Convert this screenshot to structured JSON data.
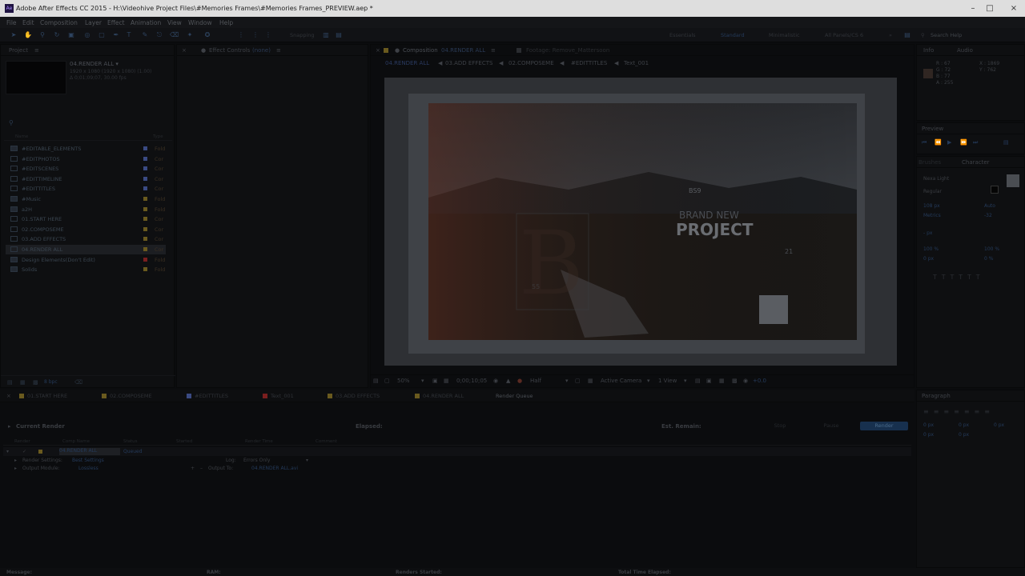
{
  "window": {
    "title": "Adobe After Effects CC 2015 - H:\\Videohive Project Files\\#Memories Frames\\#Memories Frames_PREVIEW.aep *",
    "logo_text": "Ae"
  },
  "menu": [
    "File",
    "Edit",
    "Composition",
    "Layer",
    "Effect",
    "Animation",
    "View",
    "Window",
    "Help"
  ],
  "toolbar": {
    "snapping_label": "Snapping",
    "workspaces": [
      "Essentials",
      "Standard",
      "Minimalistic",
      "All Panels/CS 6"
    ],
    "search_placeholder": "Search Help"
  },
  "project_panel": {
    "tab": "Project",
    "selected_name": "04.RENDER ALL ▾",
    "selected_info_1": "1920 x 1080  (1920 x 1080) (1.00)",
    "selected_info_2": "Δ 0;01;09;07, 30.00 fps",
    "col_name": "Name",
    "col_type": "Type",
    "items": [
      {
        "name": "#EDITABLE_ELEMENTS",
        "type": "Fold",
        "color": "#3a4a82"
      },
      {
        "name": "#EDITPHOTOS",
        "type": "Cor",
        "color": "#3a4a82"
      },
      {
        "name": "#EDITSCENES",
        "type": "Cor",
        "color": "#3a4a82"
      },
      {
        "name": "#EDITTIMELINE",
        "type": "Cor",
        "color": "#3a4a82"
      },
      {
        "name": "#EDITTITLES",
        "type": "Cor",
        "color": "#3a4a82"
      },
      {
        "name": "#Music",
        "type": "Fold",
        "color": "#6a5a1e"
      },
      {
        "name": "a2H",
        "type": "Fold",
        "color": "#6a5a1e"
      },
      {
        "name": "01.START HERE",
        "type": "Cor",
        "color": "#6a5a1e"
      },
      {
        "name": "02.COMPOSEME",
        "type": "Cor",
        "color": "#6a5a1e"
      },
      {
        "name": "03.ADD EFFECTS",
        "type": "Cor",
        "color": "#6a5a1e"
      },
      {
        "name": "04.RENDER ALL",
        "type": "Cor",
        "color": "#6a5a1e"
      },
      {
        "name": "Design Elements(Don't Edit)",
        "type": "Fold",
        "color": "#7a1e1e"
      },
      {
        "name": "Solids",
        "type": "Fold",
        "color": "#6a5a1e"
      }
    ],
    "footer_bpc": "8 bpc"
  },
  "effect_controls": {
    "tab": "Effect Controls",
    "tab_value": "(none)"
  },
  "composition_panel": {
    "tab": "Composition",
    "comp_name": "04.RENDER ALL",
    "footage_tab": "Footage: Remove_Mattersoon",
    "breadcrumbs": [
      "04.RENDER ALL",
      "03.ADD EFFECTS",
      "02.COMPOSEME",
      "#EDITTITLES",
      "Text_001"
    ],
    "overlay_small": "BS9",
    "overlay_sub": "BRAND NEW",
    "overlay_title": "PROJECT",
    "overlay_tag": "21",
    "overlay_tag2": "55",
    "overlay_letter": "B",
    "zoom": "50%",
    "timecode": "0;00;10;05",
    "resolution": "Half",
    "camera": "Active Camera",
    "views": "1 View",
    "exposure": "+0.0"
  },
  "info_panel": {
    "tab": "Info",
    "tab2": "Audio",
    "r": "R : 67",
    "g": "G : 72",
    "b": "B : 77",
    "a": "A : 255",
    "x": "X : 1869",
    "y": "Y : 762"
  },
  "preview_panel": {
    "tab": "Preview"
  },
  "character_panel": {
    "tab_brushes": "Brushes",
    "tab": "Character",
    "font": "Nexa Light",
    "style": "Regular",
    "size": "108 px",
    "leading": "Auto",
    "kerning": "Metrics",
    "tracking": "-32",
    "stroke": "- px",
    "vscale": "100 %",
    "hscale": "100 %",
    "baseline": "0 px",
    "tsume": "0 %"
  },
  "paragraph_panel": {
    "tab": "Paragraph",
    "indent1": "0 px",
    "indent2": "0 px",
    "indent3": "0 px",
    "space1": "0 px",
    "space2": "0 px"
  },
  "timeline_tabs": [
    {
      "label": "01.START HERE",
      "color": "#6a5a1e"
    },
    {
      "label": "02.COMPOSEME",
      "color": "#6a5a1e"
    },
    {
      "label": "#EDITTITLES",
      "color": "#3a4a82"
    },
    {
      "label": "Text_001",
      "color": "#7a1e1e"
    },
    {
      "label": "03.ADD EFFECTS",
      "color": "#6a5a1e"
    },
    {
      "label": "04.RENDER ALL",
      "color": "#6a5a1e"
    },
    {
      "label": "Render Queue",
      "color": ""
    }
  ],
  "render_queue": {
    "current_render": "Current Render",
    "elapsed": "Elapsed:",
    "est_remain": "Est. Remain:",
    "stop": "Stop",
    "pause": "Pause",
    "render": "Render",
    "cols": [
      "Render",
      "Comp Name",
      "Status",
      "Started",
      "Render Time",
      "Comment"
    ],
    "item_comp": "04.RENDER ALL",
    "item_status": "Queued",
    "render_settings_label": "Render Settings:",
    "render_settings_value": "Best Settings",
    "output_module_label": "Output Module:",
    "output_module_value": "Lossless",
    "log_label": "Log:",
    "log_value": "Errors Only",
    "output_to_label": "Output To:",
    "output_to_value": "04.RENDER ALL.avi"
  },
  "status_bar": {
    "message": "Message:",
    "ram": "RAM:",
    "renders_started": "Renders Started:",
    "total_time": "Total Time Elapsed:"
  }
}
